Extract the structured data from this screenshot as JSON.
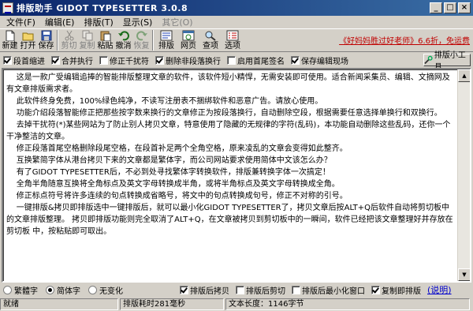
{
  "window": {
    "title": "排版助手 GIDOT TYPESETTER 3.0.8"
  },
  "menu": [
    "文件(F)",
    "编辑(E)",
    "排版(T)",
    "显示(S)",
    "其它(O)"
  ],
  "menu_disabled": [
    false,
    false,
    false,
    false,
    true
  ],
  "toolbar": {
    "buttons": [
      {
        "label": "新建",
        "icon": "new-file-icon",
        "disabled": false
      },
      {
        "label": "打开",
        "icon": "open-folder-icon",
        "disabled": false
      },
      {
        "label": "保存",
        "icon": "save-disk-icon",
        "disabled": false
      },
      {
        "label": "剪切",
        "icon": "cut-scissors-icon",
        "disabled": true
      },
      {
        "label": "复制",
        "icon": "copy-icon",
        "disabled": true
      },
      {
        "label": "粘贴",
        "icon": "paste-icon",
        "disabled": false
      },
      {
        "label": "撤消",
        "icon": "undo-icon",
        "disabled": false
      },
      {
        "label": "恢复",
        "icon": "redo-icon",
        "disabled": true
      },
      {
        "label": "排版",
        "icon": "typeset-icon",
        "disabled": false
      },
      {
        "label": "网页",
        "icon": "web-page-icon",
        "disabled": false
      },
      {
        "label": "查项",
        "icon": "find-item-icon",
        "disabled": false
      },
      {
        "label": "选项",
        "icon": "options-icon",
        "disabled": false
      }
    ],
    "promo": "《好妈妈胜过好老师》6.6折，免运费"
  },
  "options": [
    {
      "label": "段首缩进",
      "checked": true
    },
    {
      "label": "合并执行",
      "checked": true
    },
    {
      "label": "修正千扰符",
      "checked": false
    },
    {
      "label": "删除非段落换行",
      "checked": true
    },
    {
      "label": "启用首尾签名",
      "checked": false
    },
    {
      "label": "保存编辑现场",
      "checked": true
    }
  ],
  "tools_button": "排版小工具",
  "editor": {
    "paragraphs": [
      "    这是一款广受编辑追捧的智能排版整理文章的软件，该软件短小精悍，无需安装即可使用。适合新闻采集员、编辑、文摘网及有文章排版需求者。",
      "    此软件终身免费，100%绿色纯净，不读写注册表不捆绑软件和恶意广告。请放心使用。",
      "    功能介绍段落智能修正把那些按字数来换行的文章修正为按段落换行，自动删除空段，根据需要任意选择单换行和双换行。",
      "    去掉干扰符(*)某些网站为了防止别人拷贝文章，特意使用了隐藏的无规律的字符(乱码)，本功能自动删除这些乱码，还你一个干净整洁的文章。",
      "    修正段落首尾空格删除段尾空格，在段首补足两个全角空格，原来凌乱的文章会变得如此整齐。",
      "    互换繁简字体从港台拷贝下来的文章都是繁体字，而公司网站要求使用简体中文该怎么办？",
      "    有了GIDOT TYPESETTER后，不必到处寻找繁体字转换软件，排版兼转换字体一次搞定！",
      "    全角半角随意互换将全角标点及英文字母转换成半角，或将半角标点及英文字母转换成全角。",
      "    修正标点符号将许多连续的句点转换成省略号，将文中的句点转换成句号，修正不对称的引号。",
      "    一键排版&拷贝即排版选中一键排版后，就可以最小化GIDOT TYPESETTER了，拷贝文章后按ALT+Q后软件自动将剪切板中的文章排版整理。 拷贝即排版功能则完全取消了ALT+Q，在文章被拷贝到剪切板中的一瞬间，软件已经把该文章整理好并存放在剪切板 中，按粘贴即可取出。"
    ]
  },
  "bottom": {
    "radios": [
      {
        "label": "繁體字",
        "checked": false
      },
      {
        "label": "简体字",
        "checked": true
      },
      {
        "label": "无变化",
        "checked": false
      }
    ],
    "checks": [
      {
        "label": "排版后拷贝",
        "checked": true
      },
      {
        "label": "排版后剪切",
        "checked": false
      },
      {
        "label": "排版后最小化窗口",
        "checked": false
      },
      {
        "label": "复制即排版",
        "checked": true
      }
    ],
    "help": "(说明)"
  },
  "status": {
    "state": "就绪",
    "elapsed": "排版耗时281毫秒",
    "length": "文本长度：1146字节"
  }
}
